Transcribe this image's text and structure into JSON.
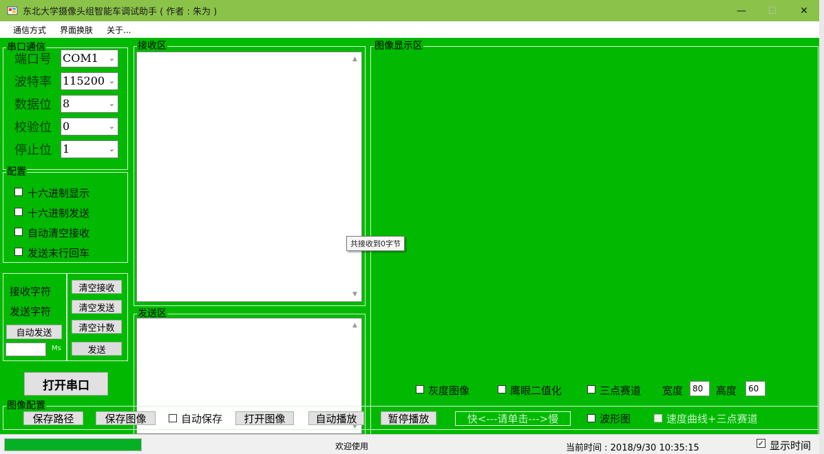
{
  "window": {
    "title": "东北大学摄像头组智能车调试助手 ( 作者 : 朱为 )",
    "minimize_glyph": "—",
    "maximize_glyph": "☐",
    "close_glyph": "✕"
  },
  "menu": [
    "通信方式",
    "界面换肤",
    "关于..."
  ],
  "serial": {
    "legend": "串口通信",
    "fields": [
      {
        "label": "端口号",
        "value": "COM1"
      },
      {
        "label": "波特率",
        "value": "115200"
      },
      {
        "label": "数据位",
        "value": "8"
      },
      {
        "label": "校验位",
        "value": "0"
      },
      {
        "label": "停止位",
        "value": "1"
      }
    ],
    "dropdown_arrow": "⌄"
  },
  "config": {
    "legend": "配置",
    "options": [
      {
        "label": "十六进制显示",
        "checked": false
      },
      {
        "label": "十六进制发送",
        "checked": false
      },
      {
        "label": "自动清空接收",
        "checked": false
      },
      {
        "label": "发送末行回车",
        "checked": false
      }
    ]
  },
  "counters": {
    "recv_label": "接收字符",
    "send_label": "发送字符",
    "auto_send": "自动发送",
    "interval_value": "",
    "interval_unit": "Ms",
    "clear_recv": "清空接收",
    "clear_send": "清空发送",
    "clear_count": "清空计数",
    "send": "发送"
  },
  "open_port": "打开串口",
  "receive": {
    "legend": "接收区",
    "text": "",
    "tooltip": "共接收到0字节"
  },
  "send_area": {
    "legend": "发送区",
    "text": ""
  },
  "image_area": {
    "legend": "图像显示区",
    "gray": "灰度图像",
    "binarize": "鹰眼二值化",
    "three_point": "三点赛道",
    "width_label": "宽度",
    "width_value": "80",
    "height_label": "高度",
    "height_value": "60"
  },
  "image_config": {
    "legend": "图像配置",
    "save_path": "保存路径",
    "save_image": "保存图像",
    "auto_save": "自动保存",
    "open_image": "打开图像",
    "auto_play": "自动播放",
    "pause_play": "暂停播放",
    "speed": "快<---请单击--->慢",
    "waveform": "波形图",
    "speed_curve": "速度曲线+三点赛道"
  },
  "status": {
    "progress": 1.0,
    "welcome": "欢迎使用",
    "time_label": "当前时间 : ",
    "time": "2018/9/30 10:35:15",
    "show_time": "显示时间",
    "show_time_checked": true
  },
  "colors": {
    "background_green": "#00b900",
    "titlebar_green": "#8bc34a",
    "progress_green": "#06b025"
  }
}
